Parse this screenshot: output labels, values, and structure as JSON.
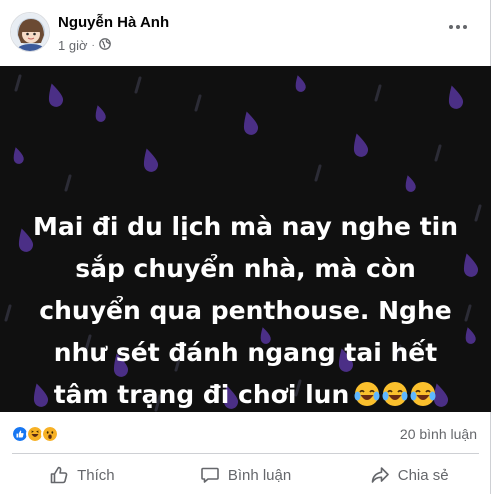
{
  "post": {
    "author": "Nguyễn Hà Anh",
    "time": "1 giờ",
    "separator": "·",
    "privacy_icon": "globe-icon",
    "more_icon": "more-options-icon"
  },
  "status": {
    "background": "#101010",
    "drop_colors": [
      "#4b2f86",
      "#2f2f3a"
    ],
    "lines": [
      "Mai đi du lịch mà nay nghe tin",
      "sắp chuyển nhà, mà còn",
      "chuyển qua penthouse. Nghe",
      "như sét đánh ngang tai hết",
      "tâm trạng đi chơi lun"
    ],
    "emojis": [
      "tears-of-joy-emoji",
      "tears-of-joy-emoji",
      "tears-of-joy-emoji"
    ]
  },
  "reactions": {
    "icons": [
      "like-reaction-icon",
      "haha-reaction-icon",
      "wow-reaction-icon"
    ],
    "comment_count": "20 bình luận"
  },
  "actions": {
    "like": "Thích",
    "comment": "Bình luận",
    "share": "Chia sẻ"
  },
  "colors": {
    "like_blue": "#1877f2",
    "reaction_yellow": "#f7b125",
    "secondary_text": "#65676b"
  }
}
